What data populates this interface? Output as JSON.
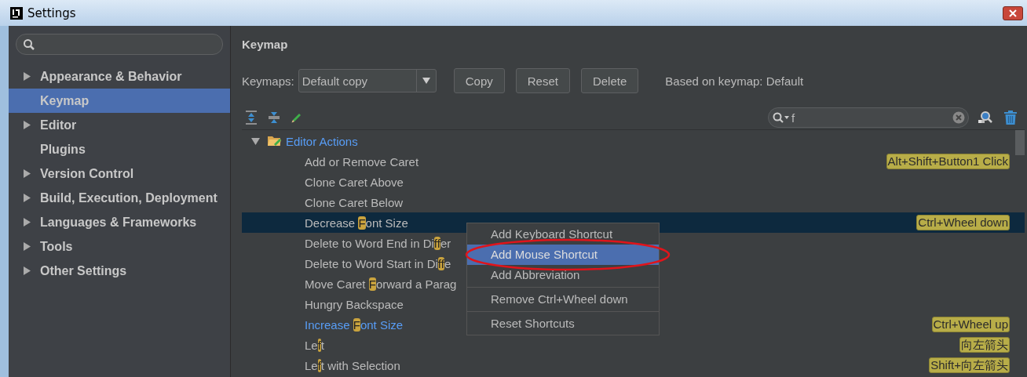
{
  "window": {
    "title": "Settings"
  },
  "sidebar": {
    "items": [
      {
        "label": "Appearance & Behavior",
        "expandable": true,
        "selected": false
      },
      {
        "label": "Keymap",
        "expandable": false,
        "selected": true
      },
      {
        "label": "Editor",
        "expandable": true,
        "selected": false
      },
      {
        "label": "Plugins",
        "expandable": false,
        "selected": false
      },
      {
        "label": "Version Control",
        "expandable": true,
        "selected": false
      },
      {
        "label": "Build, Execution, Deployment",
        "expandable": true,
        "selected": false
      },
      {
        "label": "Languages & Frameworks",
        "expandable": true,
        "selected": false
      },
      {
        "label": "Tools",
        "expandable": true,
        "selected": false
      },
      {
        "label": "Other Settings",
        "expandable": true,
        "selected": false
      }
    ]
  },
  "panel": {
    "title": "Keymap",
    "keymaps_label": "Keymaps:",
    "keymap_value": "Default copy",
    "buttons": [
      "Copy",
      "Reset",
      "Delete"
    ],
    "based_on": "Based on keymap: Default",
    "search_value": "f"
  },
  "tree": {
    "label": "Editor Actions",
    "expanded": true,
    "children": [
      {
        "name": [
          {
            "text": "Add or Remove Caret",
            "match": false
          }
        ],
        "shortcuts": [
          "Alt+Shift+Button1 Click"
        ],
        "selected": false,
        "modified": false
      },
      {
        "name": [
          {
            "text": "Clone Caret Above",
            "match": false
          }
        ],
        "selected": false,
        "modified": false
      },
      {
        "name": [
          {
            "text": "Clone Caret Below",
            "match": false
          }
        ],
        "selected": false,
        "modified": false
      },
      {
        "name": [
          {
            "text": "Decrease ",
            "match": false
          },
          {
            "text": "F",
            "match": true
          },
          {
            "text": "ont Size",
            "match": false
          }
        ],
        "shortcuts": [
          "Ctrl+Wheel down"
        ],
        "selected": true,
        "modified": false
      },
      {
        "name": [
          {
            "text": "Delete to Word End in Di",
            "match": false
          },
          {
            "text": "ff",
            "match": true
          },
          {
            "text": "er",
            "match": false
          }
        ],
        "selected": false,
        "modified": false
      },
      {
        "name": [
          {
            "text": "Delete to Word Start in Di",
            "match": false
          },
          {
            "text": "ff",
            "match": true
          },
          {
            "text": "e",
            "match": false
          }
        ],
        "selected": false,
        "modified": false
      },
      {
        "name": [
          {
            "text": "Move Caret ",
            "match": false
          },
          {
            "text": "F",
            "match": true
          },
          {
            "text": "orward a Parag",
            "match": false
          }
        ],
        "selected": false,
        "modified": false
      },
      {
        "name": [
          {
            "text": "Hungry Backspace",
            "match": false
          }
        ],
        "selected": false,
        "modified": false
      },
      {
        "name": [
          {
            "text": "Increase ",
            "match": false
          },
          {
            "text": "F",
            "match": true
          },
          {
            "text": "ont Size",
            "match": false
          }
        ],
        "shortcuts": [
          "Ctrl+Wheel up"
        ],
        "selected": false,
        "modified": true
      },
      {
        "name": [
          {
            "text": "Le",
            "match": false
          },
          {
            "text": "f",
            "match": true
          },
          {
            "text": "t",
            "match": false
          }
        ],
        "shortcuts": [
          "向左箭头"
        ],
        "selected": false,
        "modified": false
      },
      {
        "name": [
          {
            "text": "Le",
            "match": false
          },
          {
            "text": "f",
            "match": true
          },
          {
            "text": "t with Selection",
            "match": false
          }
        ],
        "shortcuts": [
          "Shift+向左箭头"
        ],
        "selected": false,
        "modified": false
      }
    ]
  },
  "context_menu": {
    "items": [
      {
        "label": "Add Keyboard Shortcut",
        "selected": false,
        "separator_before": false
      },
      {
        "label": "Add Mouse Shortcut",
        "selected": true,
        "separator_before": false
      },
      {
        "label": "Add Abbreviation",
        "selected": false,
        "separator_before": false
      },
      {
        "label": "Remove Ctrl+Wheel down",
        "selected": false,
        "separator_before": true
      },
      {
        "label": "Reset Shortcuts",
        "selected": false,
        "separator_before": true
      }
    ]
  }
}
